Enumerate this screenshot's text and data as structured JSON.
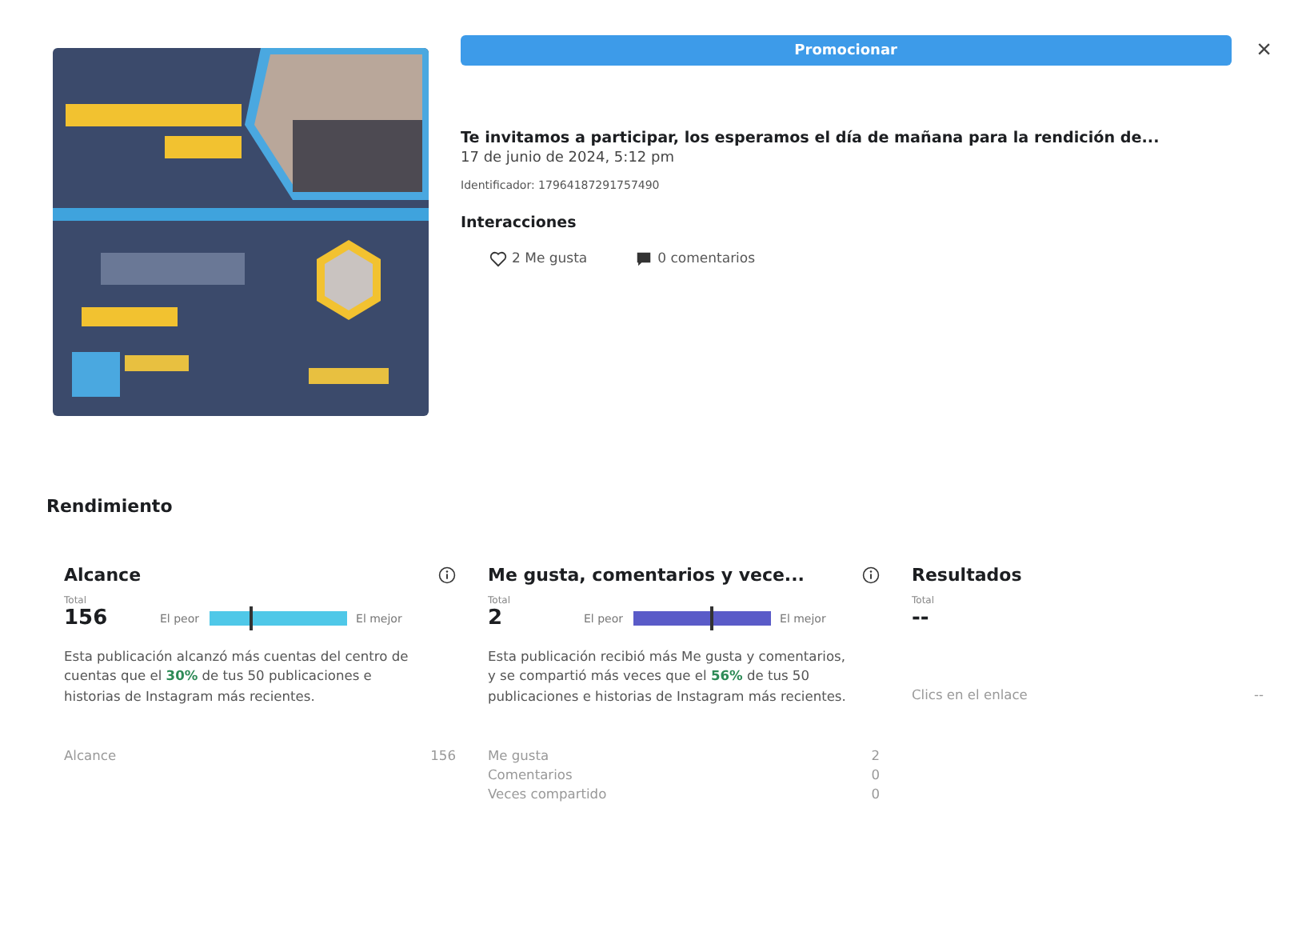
{
  "post": {
    "promote_button": "Promocionar",
    "close": "×",
    "title": "Te invitamos a participar, los esperamos el día de mañana para la rendición de...",
    "date": "17 de junio de 2024, 5:12 pm",
    "identifier": "Identificador: 17964187291757490",
    "interactions_heading": "Interacciones",
    "likes": "2 Me gusta",
    "comments": "0 comentarios"
  },
  "performance": {
    "heading": "Rendimiento",
    "cards": [
      {
        "kind": "meter",
        "title": "Alcance",
        "total_label": "Total",
        "total": "156",
        "worst": "El peor",
        "best": "El mejor",
        "level": 0.3,
        "color": "#4fc8e8",
        "description": "Esta publicación alcanzó más cuentas del centro de cuentas que el **30%** de tus 50 publicaciones e historias de Instagram más recientes.",
        "rows": [
          {
            "label": "Alcance",
            "value": "156"
          }
        ]
      },
      {
        "kind": "meter",
        "title": "Me gusta, comentarios y vece...",
        "total_label": "Total",
        "total": "2",
        "worst": "El peor",
        "best": "El mejor",
        "level": 0.56,
        "color": "#5a5bc8",
        "description": "Esta publicación recibió más Me gusta y comentarios, y se compartió más veces que el **56%** de tus 50 publicaciones e historias de Instagram más recientes.",
        "rows": [
          {
            "label": "Me gusta",
            "value": "2"
          },
          {
            "label": "Comentarios",
            "value": "0"
          },
          {
            "label": "Veces compartido",
            "value": "0"
          }
        ]
      },
      {
        "kind": "plain",
        "title": "Resultados",
        "total_label": "Total",
        "total": "--",
        "rows": [
          {
            "label": "Clics en el enlace",
            "value": "--"
          }
        ]
      }
    ]
  }
}
